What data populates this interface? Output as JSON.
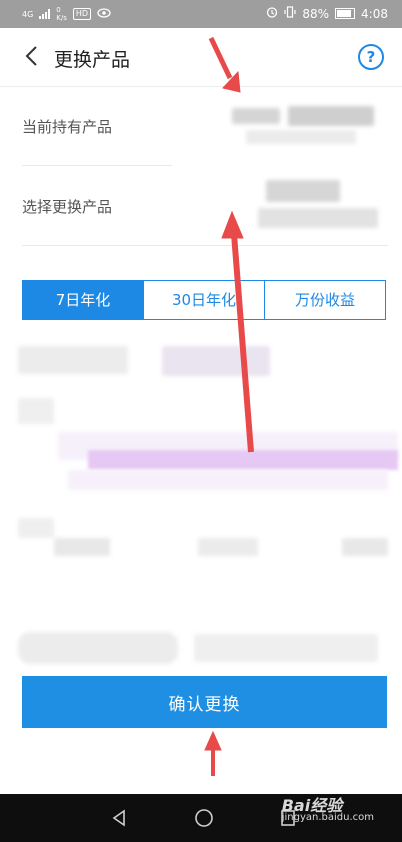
{
  "status_bar": {
    "network": "4G",
    "speed_value": "0",
    "speed_unit": "K/s",
    "hd_label": "HD",
    "battery": "88%",
    "time": "4:08"
  },
  "header": {
    "title": "更换产品",
    "help_symbol": "?"
  },
  "form": {
    "current_label": "当前持有产品",
    "select_label": "选择更换产品"
  },
  "tabs": [
    {
      "label": "7日年化",
      "active": true
    },
    {
      "label": "30日年化",
      "active": false
    },
    {
      "label": "万份收益",
      "active": false
    }
  ],
  "confirm_button": "确认更换",
  "watermark": {
    "brand": "Bai经验",
    "url": "jingyan.baidu.com"
  },
  "colors": {
    "accent": "#1e88e5",
    "annotation_arrow": "#e84a4a"
  },
  "icons": [
    "signal-icon",
    "hd-icon",
    "eye-icon",
    "alarm-icon",
    "vibrate-icon",
    "battery-icon",
    "back-icon",
    "help-icon",
    "nav-back-icon",
    "nav-home-icon",
    "nav-recents-icon"
  ]
}
